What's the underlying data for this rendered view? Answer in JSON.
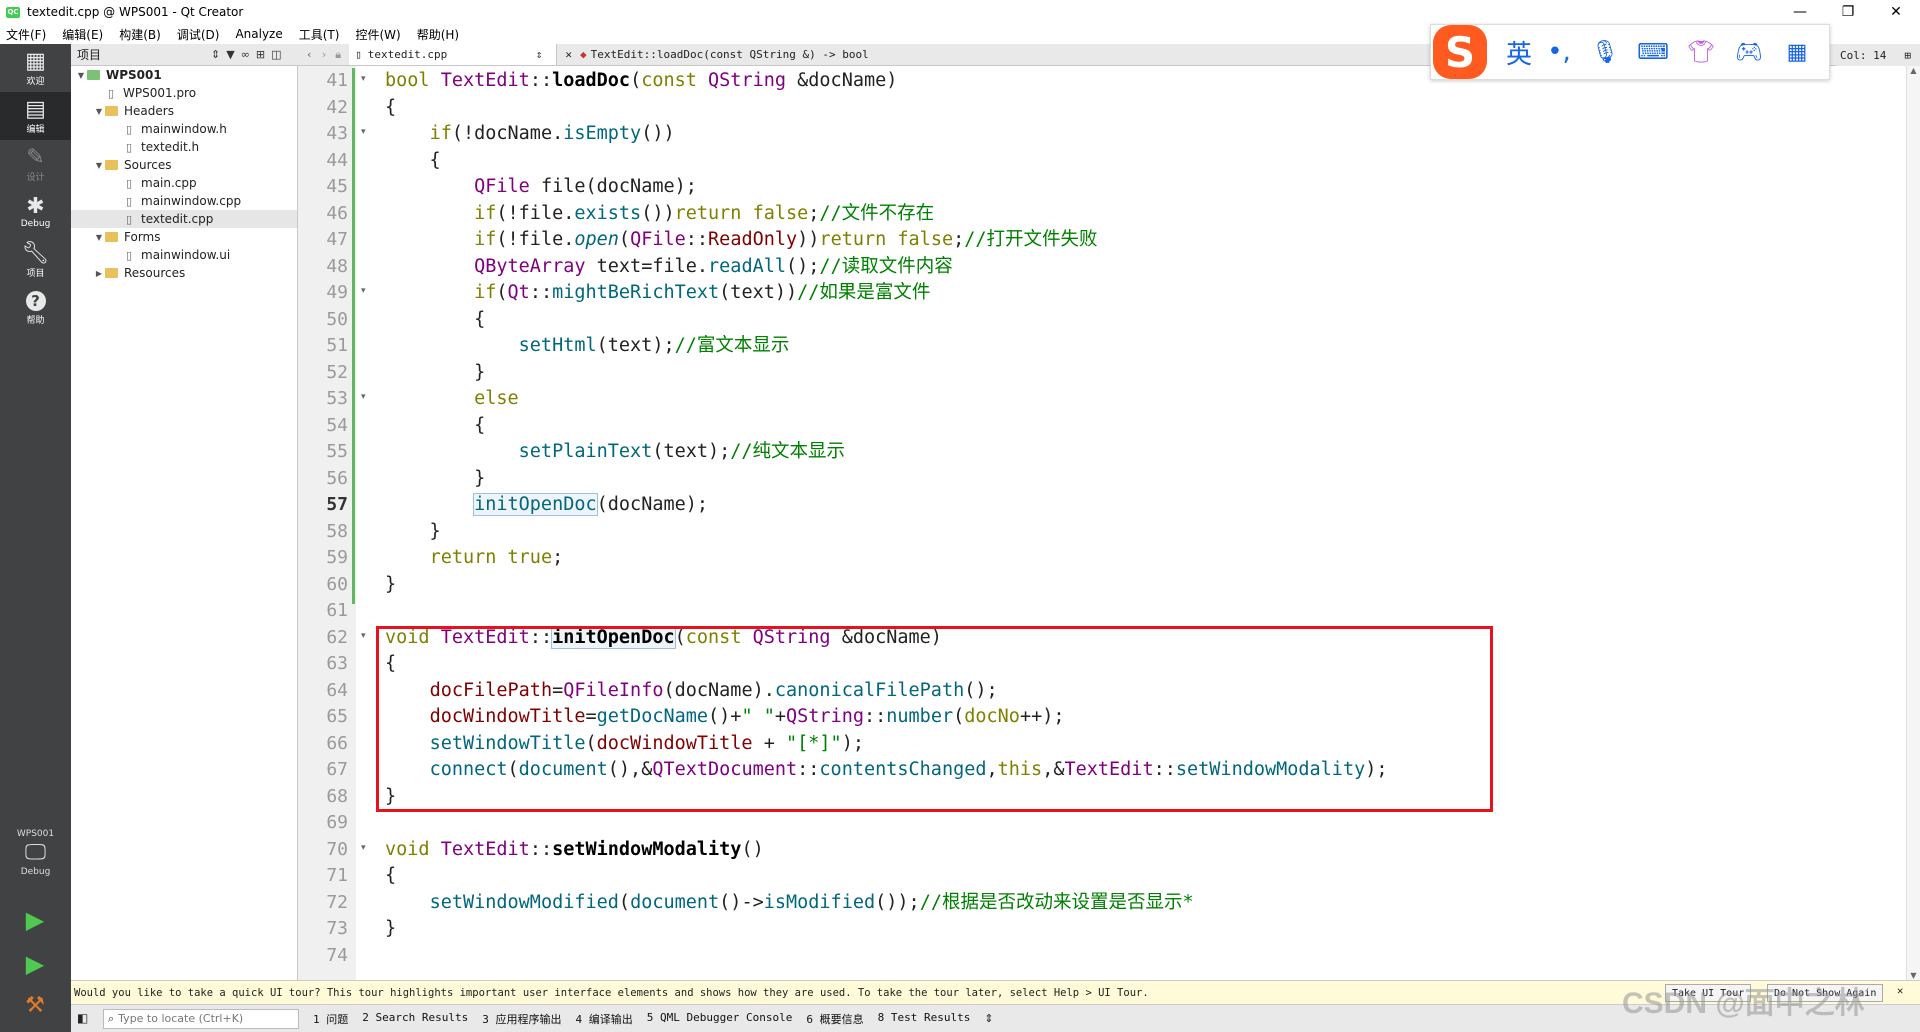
{
  "window": {
    "title": "textedit.cpp @ WPS001 - Qt Creator",
    "app_icon_text": "QC"
  },
  "menu": [
    "文件(F)",
    "编辑(E)",
    "构建(B)",
    "调试(D)",
    "Analyze",
    "工具(T)",
    "控件(W)",
    "帮助(H)"
  ],
  "modes": [
    {
      "label": "欢迎",
      "icon": "grid-icon"
    },
    {
      "label": "编辑",
      "icon": "edit-icon"
    },
    {
      "label": "设计",
      "icon": "pen-icon"
    },
    {
      "label": "Debug",
      "icon": "bug-icon"
    },
    {
      "label": "项目",
      "icon": "wrench-icon"
    },
    {
      "label": "帮助",
      "icon": "help-icon"
    }
  ],
  "kit": {
    "name": "WPS001",
    "mode": "Debug"
  },
  "projects": {
    "selector": "项目",
    "tree": [
      {
        "label": "WPS001",
        "depth": 0,
        "arrow": "▼",
        "kind": "project",
        "bold": true
      },
      {
        "label": "WPS001.pro",
        "depth": 1,
        "arrow": "",
        "kind": "file"
      },
      {
        "label": "Headers",
        "depth": 1,
        "arrow": "▼",
        "kind": "folder"
      },
      {
        "label": "mainwindow.h",
        "depth": 2,
        "arrow": "",
        "kind": "file"
      },
      {
        "label": "textedit.h",
        "depth": 2,
        "arrow": "",
        "kind": "file"
      },
      {
        "label": "Sources",
        "depth": 1,
        "arrow": "▼",
        "kind": "folder"
      },
      {
        "label": "main.cpp",
        "depth": 2,
        "arrow": "",
        "kind": "file"
      },
      {
        "label": "mainwindow.cpp",
        "depth": 2,
        "arrow": "",
        "kind": "file"
      },
      {
        "label": "textedit.cpp",
        "depth": 2,
        "arrow": "",
        "kind": "file",
        "selected": true
      },
      {
        "label": "Forms",
        "depth": 1,
        "arrow": "▼",
        "kind": "folder"
      },
      {
        "label": "mainwindow.ui",
        "depth": 2,
        "arrow": "",
        "kind": "file"
      },
      {
        "label": "Resources",
        "depth": 1,
        "arrow": "▶",
        "kind": "folder"
      }
    ]
  },
  "editor": {
    "file_tab": "textedit.cpp",
    "symbol": "TextEdit::loadDoc(const QString &) -> bool",
    "column": "Col: 14",
    "current_line": 57,
    "lines": [
      {
        "n": 41,
        "fold": true,
        "tokens": [
          [
            "kw",
            "bool "
          ],
          [
            "ty",
            "TextEdit"
          ],
          [
            "",
            "::"
          ],
          [
            "fnb",
            "loadDoc"
          ],
          [
            "",
            "("
          ],
          [
            "kw",
            "const "
          ],
          [
            "ty",
            "QString"
          ],
          [
            "",
            " &docName)"
          ]
        ]
      },
      {
        "n": 42,
        "tokens": [
          [
            "",
            "{"
          ]
        ]
      },
      {
        "n": 43,
        "fold": true,
        "tokens": [
          [
            "",
            "    "
          ],
          [
            "kw",
            "if"
          ],
          [
            "",
            "(!docName."
          ],
          [
            "fn",
            "isEmpty"
          ],
          [
            "",
            "())"
          ]
        ]
      },
      {
        "n": 44,
        "tokens": [
          [
            "",
            "    {"
          ]
        ]
      },
      {
        "n": 45,
        "tokens": [
          [
            "",
            "        "
          ],
          [
            "ty",
            "QFile"
          ],
          [
            "",
            " file(docName);"
          ]
        ]
      },
      {
        "n": 46,
        "tokens": [
          [
            "",
            "        "
          ],
          [
            "kw",
            "if"
          ],
          [
            "",
            "(!file."
          ],
          [
            "fn",
            "exists"
          ],
          [
            "",
            "())"
          ],
          [
            "kw",
            "return false"
          ],
          [
            "",
            ";"
          ],
          [
            "cm",
            "//文件不存在"
          ]
        ]
      },
      {
        "n": 47,
        "tokens": [
          [
            "",
            "        "
          ],
          [
            "kw",
            "if"
          ],
          [
            "",
            "(!file."
          ],
          [
            "fn it",
            "open"
          ],
          [
            "",
            "("
          ],
          [
            "ty",
            "QFile"
          ],
          [
            "",
            "::"
          ],
          [
            "mem",
            "ReadOnly"
          ],
          [
            "",
            "))"
          ],
          [
            "kw",
            "return false"
          ],
          [
            "",
            ";"
          ],
          [
            "cm",
            "//打开文件失败"
          ]
        ]
      },
      {
        "n": 48,
        "tokens": [
          [
            "",
            "        "
          ],
          [
            "ty",
            "QByteArray"
          ],
          [
            "",
            " text=file."
          ],
          [
            "fn",
            "readAll"
          ],
          [
            "",
            "();"
          ],
          [
            "cm",
            "//读取文件内容"
          ]
        ]
      },
      {
        "n": 49,
        "fold": true,
        "tokens": [
          [
            "",
            "        "
          ],
          [
            "kw",
            "if"
          ],
          [
            "",
            "("
          ],
          [
            "ty",
            "Qt"
          ],
          [
            "",
            "::"
          ],
          [
            "fn",
            "mightBeRichText"
          ],
          [
            "",
            "(text))"
          ],
          [
            "cm",
            "//如果是富文件"
          ]
        ]
      },
      {
        "n": 50,
        "tokens": [
          [
            "",
            "        {"
          ]
        ]
      },
      {
        "n": 51,
        "tokens": [
          [
            "",
            "            "
          ],
          [
            "fn",
            "setHtml"
          ],
          [
            "",
            "(text);"
          ],
          [
            "cm",
            "//富文本显示"
          ]
        ]
      },
      {
        "n": 52,
        "tokens": [
          [
            "",
            "        }"
          ]
        ]
      },
      {
        "n": 53,
        "fold": true,
        "tokens": [
          [
            "",
            "        "
          ],
          [
            "kw",
            "else"
          ]
        ]
      },
      {
        "n": 54,
        "tokens": [
          [
            "",
            "        {"
          ]
        ]
      },
      {
        "n": 55,
        "tokens": [
          [
            "",
            "            "
          ],
          [
            "fn",
            "setPlainText"
          ],
          [
            "",
            "(text);"
          ],
          [
            "cm",
            "//纯文本显示"
          ]
        ]
      },
      {
        "n": 56,
        "tokens": [
          [
            "",
            "        }"
          ]
        ]
      },
      {
        "n": 57,
        "tokens": [
          [
            "",
            "        "
          ],
          [
            "fn hl",
            "initOpenDoc"
          ],
          [
            "",
            "(docName);"
          ]
        ]
      },
      {
        "n": 58,
        "tokens": [
          [
            "",
            "    }"
          ]
        ]
      },
      {
        "n": 59,
        "tokens": [
          [
            "",
            "    "
          ],
          [
            "kw",
            "return true"
          ],
          [
            "",
            ";"
          ]
        ]
      },
      {
        "n": 60,
        "tokens": [
          [
            "",
            "}"
          ]
        ]
      },
      {
        "n": 61,
        "tokens": []
      },
      {
        "n": 62,
        "fold": true,
        "tokens": [
          [
            "kw",
            "void "
          ],
          [
            "ty",
            "TextEdit"
          ],
          [
            "",
            "::"
          ],
          [
            "fnb hl",
            "initOpenDoc"
          ],
          [
            "",
            "("
          ],
          [
            "kw",
            "const "
          ],
          [
            "ty",
            "QString"
          ],
          [
            "",
            " &docName)"
          ]
        ]
      },
      {
        "n": 63,
        "tokens": [
          [
            "",
            "{"
          ]
        ]
      },
      {
        "n": 64,
        "tokens": [
          [
            "",
            "    "
          ],
          [
            "mem",
            "docFilePath"
          ],
          [
            "",
            "="
          ],
          [
            "ty",
            "QFileInfo"
          ],
          [
            "",
            "(docName)."
          ],
          [
            "fn",
            "canonicalFilePath"
          ],
          [
            "",
            "();"
          ]
        ]
      },
      {
        "n": 65,
        "tokens": [
          [
            "",
            "    "
          ],
          [
            "mem",
            "docWindowTitle"
          ],
          [
            "",
            "="
          ],
          [
            "fn",
            "getDocName"
          ],
          [
            "",
            "()+"
          ],
          [
            "st",
            "\" \""
          ],
          [
            "",
            "+"
          ],
          [
            "ty",
            "QString"
          ],
          [
            "",
            "::"
          ],
          [
            "fn",
            "number"
          ],
          [
            "",
            "("
          ],
          [
            "kw",
            "docNo"
          ],
          [
            "",
            "++);"
          ]
        ]
      },
      {
        "n": 66,
        "tokens": [
          [
            "",
            "    "
          ],
          [
            "fn",
            "setWindowTitle"
          ],
          [
            "",
            "("
          ],
          [
            "mem",
            "docWindowTitle"
          ],
          [
            "",
            " + "
          ],
          [
            "st",
            "\"[*]\""
          ],
          [
            "",
            ");"
          ]
        ]
      },
      {
        "n": 67,
        "tokens": [
          [
            "",
            "    "
          ],
          [
            "fn",
            "connect"
          ],
          [
            "",
            "("
          ],
          [
            "fn",
            "document"
          ],
          [
            "",
            "(),&"
          ],
          [
            "ty",
            "QTextDocument"
          ],
          [
            "",
            "::"
          ],
          [
            "fn",
            "contentsChanged"
          ],
          [
            "",
            ","
          ],
          [
            "kw",
            "this"
          ],
          [
            "",
            ",&"
          ],
          [
            "ty",
            "TextEdit"
          ],
          [
            "",
            "::"
          ],
          [
            "fn",
            "setWindowModality"
          ],
          [
            "",
            ");"
          ]
        ]
      },
      {
        "n": 68,
        "tokens": [
          [
            "",
            "}"
          ]
        ]
      },
      {
        "n": 69,
        "tokens": []
      },
      {
        "n": 70,
        "fold": true,
        "tokens": [
          [
            "kw",
            "void "
          ],
          [
            "ty",
            "TextEdit"
          ],
          [
            "",
            "::"
          ],
          [
            "fnb",
            "setWindowModality"
          ],
          [
            "",
            "()"
          ]
        ]
      },
      {
        "n": 71,
        "tokens": [
          [
            "",
            "{"
          ]
        ]
      },
      {
        "n": 72,
        "tokens": [
          [
            "",
            "    "
          ],
          [
            "fn",
            "setWindowModified"
          ],
          [
            "",
            "("
          ],
          [
            "fn",
            "document"
          ],
          [
            "",
            "()->"
          ],
          [
            "fn",
            "isModified"
          ],
          [
            "",
            "());"
          ],
          [
            "cm",
            "//根据是否改动来设置是否显示*"
          ]
        ]
      },
      {
        "n": 73,
        "tokens": [
          [
            "",
            "}"
          ]
        ]
      },
      {
        "n": 74,
        "tokens": []
      }
    ]
  },
  "ime": {
    "logo": "S",
    "lang": "英",
    "punct": "•,",
    "tools": [
      "mic-icon",
      "keyboard-icon",
      "shirt-icon",
      "gamepad-icon",
      "apps-icon"
    ]
  },
  "tour": {
    "message": "Would you like to take a quick UI tour? This tour highlights important user interface elements and shows how they are used. To take the tour later, select Help > UI Tour.",
    "take_label": "Take UI Tour",
    "dismiss_label": "Do Not Show Again"
  },
  "status": {
    "locate_placeholder": "Type to locate (Ctrl+K)",
    "panes": [
      "1 问题",
      "2 Search Results",
      "3 应用程序输出",
      "4 编译输出",
      "5 QML Debugger Console",
      "6 概要信息",
      "8 Test Results"
    ]
  },
  "watermark": "CSDN @面中之林"
}
